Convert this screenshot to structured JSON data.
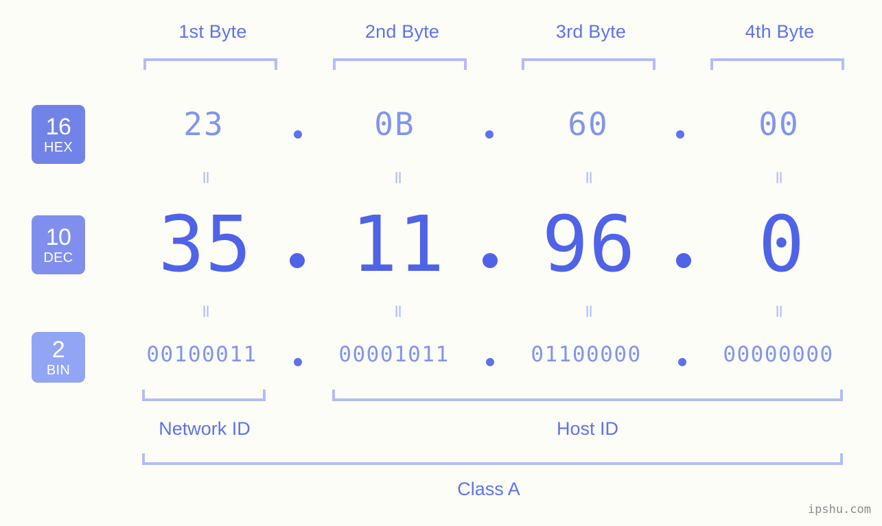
{
  "background_color": "#fcfdf7",
  "accent_color": "#4f63e8",
  "light_accent_color": "#8195ee",
  "bracket_color": "#b2bdf7",
  "header": {
    "byte_labels": [
      {
        "label": "1st Byte"
      },
      {
        "label": "2nd Byte"
      },
      {
        "label": "3rd Byte"
      },
      {
        "label": "4th Byte"
      }
    ]
  },
  "rows": [
    {
      "key": "hex",
      "base": "16",
      "abbr": "HEX",
      "badge_color": "#7283e8",
      "values": [
        "23",
        "0B",
        "60",
        "00"
      ],
      "separator": "."
    },
    {
      "key": "dec",
      "base": "10",
      "abbr": "DEC",
      "badge_color": "#808fee",
      "values": [
        "35",
        "11",
        "96",
        "0"
      ],
      "separator": "."
    },
    {
      "key": "bin",
      "base": "2",
      "abbr": "BIN",
      "badge_color": "#92a5f5",
      "values": [
        "00100011",
        "00001011",
        "01100000",
        "00000000"
      ],
      "separator": "."
    }
  ],
  "equals_marks": {
    "glyph": "=",
    "top_row": [
      "=",
      "=",
      "=",
      "="
    ],
    "bottom_row": [
      "=",
      "=",
      "=",
      "="
    ]
  },
  "footer": {
    "network_id_label": "Network ID",
    "host_id_label": "Host ID",
    "class_label": "Class A"
  },
  "watermark": "ipshu.com",
  "chart_data": {
    "type": "table",
    "title": "IP Address Byte Breakdown",
    "address_decimal": "35.11.96.0",
    "address_hex": "23.0B.60.00",
    "address_binary": "00100011.00001011.01100000.00000000",
    "ip_class": "Class A",
    "categories": [
      "1st Byte",
      "2nd Byte",
      "3rd Byte",
      "4th Byte"
    ],
    "series": [
      {
        "name": "HEX",
        "values": [
          "23",
          "0B",
          "60",
          "00"
        ]
      },
      {
        "name": "DEC",
        "values": [
          "35",
          "11",
          "96",
          "0"
        ]
      },
      {
        "name": "BIN",
        "values": [
          "00100011",
          "00001011",
          "01100000",
          "00000000"
        ]
      }
    ],
    "groupings": [
      {
        "name": "Network ID",
        "bytes": [
          "1st Byte"
        ]
      },
      {
        "name": "Host ID",
        "bytes": [
          "2nd Byte",
          "3rd Byte",
          "4th Byte"
        ]
      },
      {
        "name": "Class A",
        "bytes": [
          "1st Byte",
          "2nd Byte",
          "3rd Byte",
          "4th Byte"
        ]
      }
    ]
  }
}
